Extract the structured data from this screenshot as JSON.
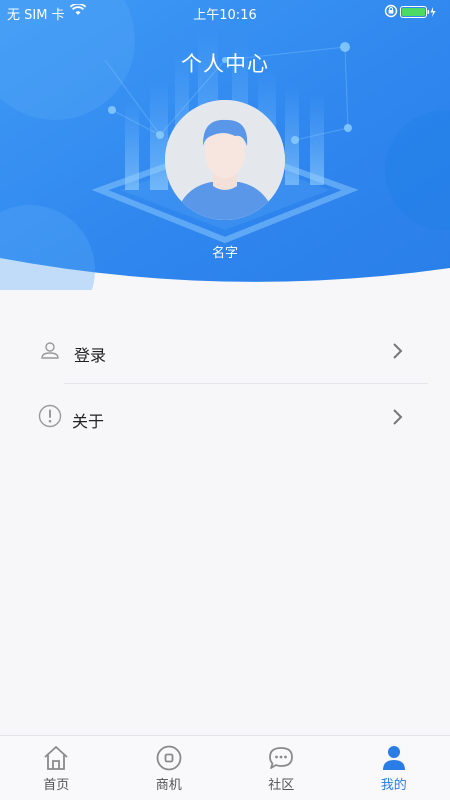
{
  "status_bar": {
    "carrier": "无 SIM 卡",
    "time": "上午10:16"
  },
  "header": {
    "title": "个人中心",
    "user_name": "名字"
  },
  "menu": {
    "items": [
      {
        "label": "登录",
        "icon": "person-icon"
      },
      {
        "label": "关于",
        "icon": "info-icon"
      }
    ]
  },
  "tabbar": {
    "items": [
      {
        "label": "首页",
        "icon": "home-icon",
        "active": false
      },
      {
        "label": "商机",
        "icon": "target-icon",
        "active": false
      },
      {
        "label": "社区",
        "icon": "chat-icon",
        "active": false
      },
      {
        "label": "我的",
        "icon": "profile-icon",
        "active": true
      }
    ]
  },
  "colors": {
    "header_blue": "#2f8cf0",
    "accent": "#2a7ce6",
    "background": "#f7f7fa"
  }
}
